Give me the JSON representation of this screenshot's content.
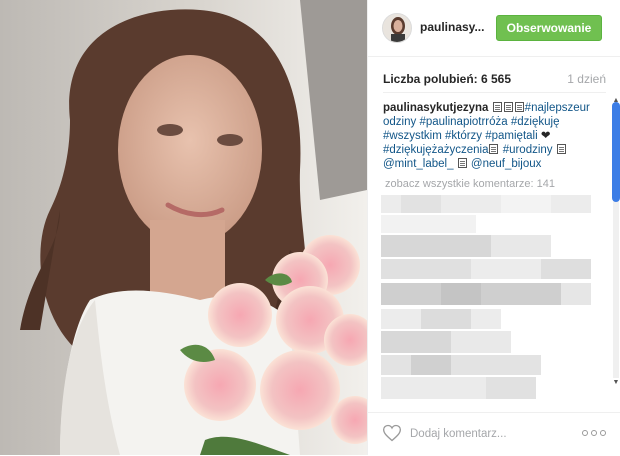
{
  "post": {
    "username": "paulinasy...",
    "follow_label": "Obserwowanie",
    "likes_text": "Liczba polubień: 6 565",
    "time_ago": "1 dzień",
    "caption": {
      "author": "paulinasykutjezyna",
      "line1_tag": "#najlepszeur",
      "line2": "odziny",
      "line2_tags": "#paulinapiotrróża #dziękuję",
      "line3_tags": "#wszystkim #którzy #pamiętali",
      "line3_heart": "❤",
      "line4_tag1": "#dziękujężażyczenia",
      "line4_tag2": "#urodziny",
      "line5_mention1": "@mint_label_",
      "line5_mention2": "@neuf_bijoux"
    },
    "view_all_comments": "zobacz wszystkie komentarze: 141",
    "comment_placeholder": "Dodaj komentarz..."
  },
  "icons": {
    "like": "heart-icon",
    "more": "more-options-icon",
    "scroll_up": "scroll-up-arrow-icon",
    "scroll_down": "scroll-down-arrow-icon"
  },
  "colors": {
    "follow_button": "#70c050",
    "hashtag": "#125688",
    "muted": "#a5a7aa",
    "scroll_thumb": "#3c7de6"
  }
}
